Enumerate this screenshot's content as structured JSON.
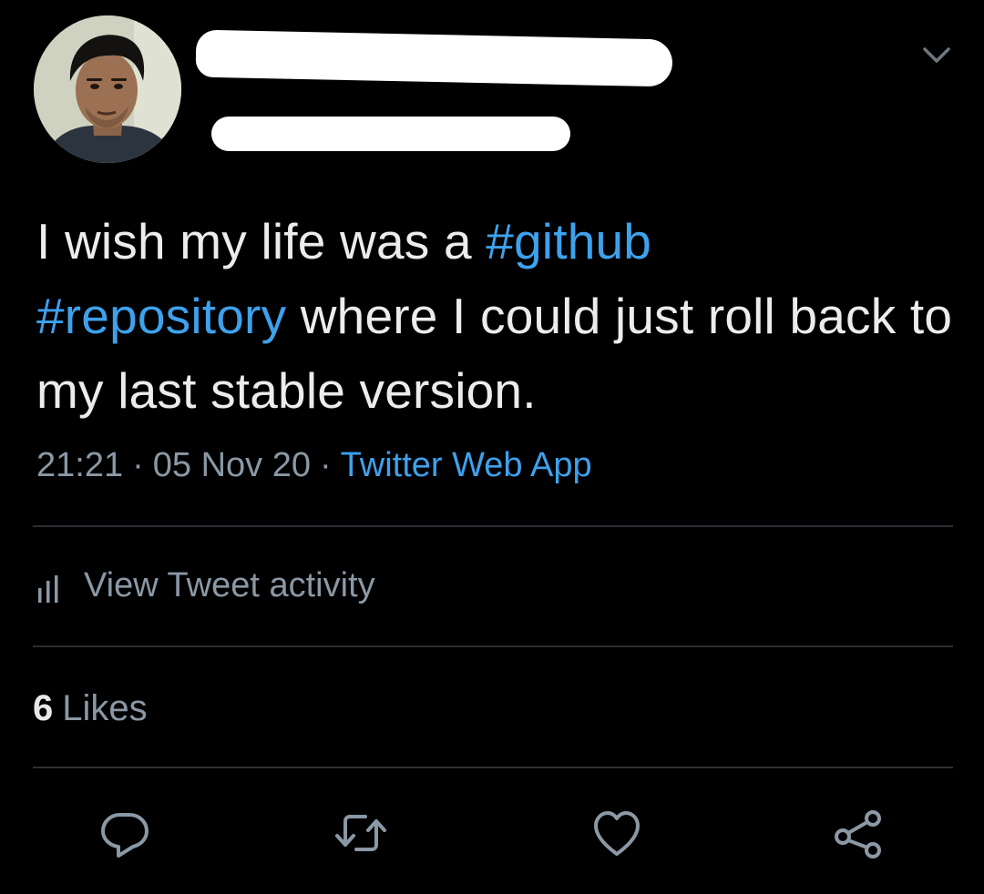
{
  "tweet": {
    "text_segments": [
      {
        "text": "I wish my life was a ",
        "type": "text"
      },
      {
        "text": "#github",
        "type": "hashtag"
      },
      {
        "text": " ",
        "type": "text"
      },
      {
        "text": "#repository",
        "type": "hashtag"
      },
      {
        "text": " where I could just roll back to my last stable version.",
        "type": "text"
      }
    ],
    "time": "21:21",
    "separator": "·",
    "date": "05 Nov 20",
    "source": "Twitter Web App",
    "activity_label": "View Tweet activity",
    "likes_count": "6",
    "likes_label": "Likes"
  },
  "colors": {
    "background": "#000000",
    "text": "#ececec",
    "secondary_text": "#8b98a5",
    "link": "#3ea1ec",
    "divider": "#2b2f33"
  },
  "icons": {
    "menu": "chevron-down-icon",
    "activity": "bar-chart-icon",
    "reply": "reply-icon",
    "retweet": "retweet-icon",
    "like": "heart-icon",
    "share": "share-icon"
  }
}
